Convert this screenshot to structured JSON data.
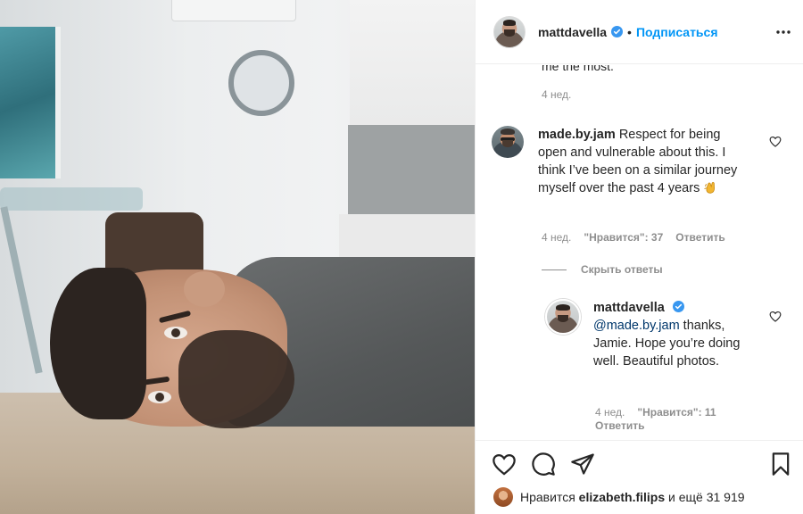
{
  "header": {
    "username": "mattdavella",
    "separator": "•",
    "follow_label": "Подписаться"
  },
  "top_comment": {
    "cut_text": "me the most.",
    "time": "4 нед."
  },
  "comment": {
    "username": "made.by.jam",
    "text": "Respect for being open and vulnerable about this. I think I’ve been on a similar journey myself over the past 4 years",
    "emoji": "clapping-hands",
    "time": "4 нед.",
    "likes": "\"Нравится\": 37",
    "reply_label": "Ответить"
  },
  "hide_replies_label": "Скрыть ответы",
  "reply": {
    "username": "mattdavella",
    "mention": "@made.by.jam",
    "text": " thanks, Jamie. Hope you’re doing well. Beautiful photos.",
    "time": "4 нед.",
    "likes": "\"Нравится\": 11",
    "reply_label": "Ответить"
  },
  "likes_line": {
    "prefix": "Нравится",
    "user": "elizabeth.filips",
    "suffix": "и ещё 31 919"
  },
  "colors": {
    "accent": "#0095f6",
    "text": "#262626",
    "muted": "#8e8e8e",
    "mention": "#00376b"
  }
}
